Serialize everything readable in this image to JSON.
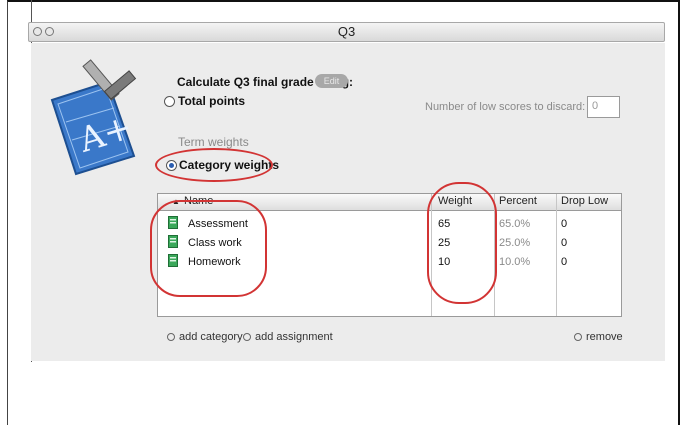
{
  "window": {
    "title": "Q3"
  },
  "settings": {
    "calc_label": "Calculate Q3 final grade using:",
    "pill_label": "Edit",
    "total_points_label": "Total points",
    "term_weights_label": "Term weights",
    "category_weights_label": "Category weights",
    "discard_label": "Number of low scores to discard:",
    "discard_value": "0",
    "selected_method": "Category weights"
  },
  "table": {
    "columns": [
      "Name",
      "Weight",
      "Percent",
      "Drop Low"
    ],
    "sort_indicator": "▲",
    "rows": [
      {
        "name": "Assessment",
        "weight": "65",
        "percent": "65.0%",
        "drop_low": "0"
      },
      {
        "name": "Class work",
        "weight": "25",
        "percent": "25.0%",
        "drop_low": "0"
      },
      {
        "name": "Homework",
        "weight": "10",
        "percent": "10.0%",
        "drop_low": "0"
      }
    ]
  },
  "actions": {
    "add_category": "add category",
    "add_assignment": "add assignment",
    "remove": "remove"
  },
  "colors": {
    "annotation": "#d23434",
    "icon_blue": "#3a78c9",
    "row_icon_green": "#3aa85a"
  }
}
